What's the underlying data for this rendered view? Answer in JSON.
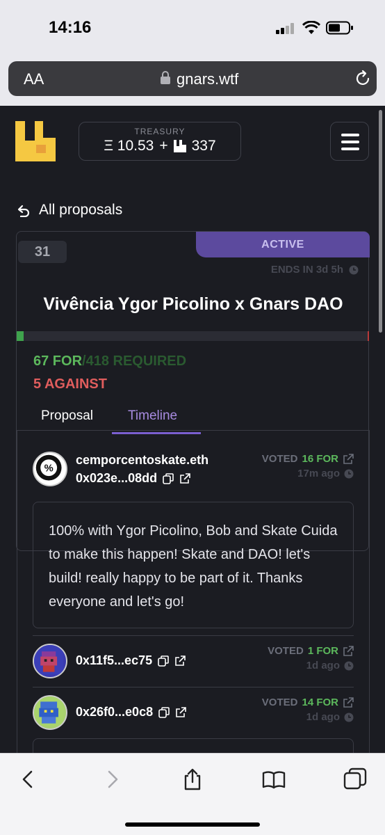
{
  "status_bar": {
    "time": "14:16"
  },
  "browser": {
    "aa_label": "AA",
    "url": "gnars.wtf"
  },
  "header": {
    "treasury_label": "TREASURY",
    "treasury_eth": "Ξ 10.53",
    "treasury_plus": "+",
    "treasury_gnars": "337"
  },
  "nav": {
    "back_label": "All proposals"
  },
  "proposal": {
    "number": "31",
    "status": "ACTIVE",
    "ends_in": "ENDS IN 3d 5h",
    "title": "Vivência Ygor Picolino x Gnars DAO",
    "for_votes": 67,
    "against_votes": 5,
    "required_votes": 418,
    "for_text": "67 FOR",
    "required_text": "/418 REQUIRED",
    "against_text": "5 AGAINST",
    "tabs": [
      {
        "label": "Proposal",
        "active": false
      },
      {
        "label": "Timeline",
        "active": true
      }
    ]
  },
  "timeline": [
    {
      "name": "cemporcentoskate.eth",
      "address": "0x023e...08dd",
      "voted_label": "VOTED",
      "votes": "16 FOR",
      "time": "17m ago",
      "comment": "100% with Ygor Picolino, Bob and Skate Cuida to make this happen! Skate and DAO! let's build! really happy to be part of it. Thanks everyone and let's go!"
    },
    {
      "address": "0x11f5...ec75",
      "voted_label": "VOTED",
      "votes": "1 FOR",
      "time": "1d ago"
    },
    {
      "address": "0x26f0...e0c8",
      "voted_label": "VOTED",
      "votes": "14 FOR",
      "time": "1d ago"
    }
  ],
  "colors": {
    "background": "#1b1c22",
    "accent": "#7a5fd0",
    "for": "#5cb85c",
    "against": "#e05d5d",
    "logo": "#f5c842"
  },
  "icons": [
    "signal-icon",
    "wifi-icon",
    "battery-icon",
    "lock-icon",
    "reload-icon",
    "gnars-logo",
    "gnars-token-icon",
    "menu-icon",
    "back-arrow-icon",
    "clock-icon",
    "copy-icon",
    "external-link-icon",
    "back-icon",
    "forward-icon",
    "share-icon",
    "bookmarks-icon",
    "tabs-icon"
  ]
}
